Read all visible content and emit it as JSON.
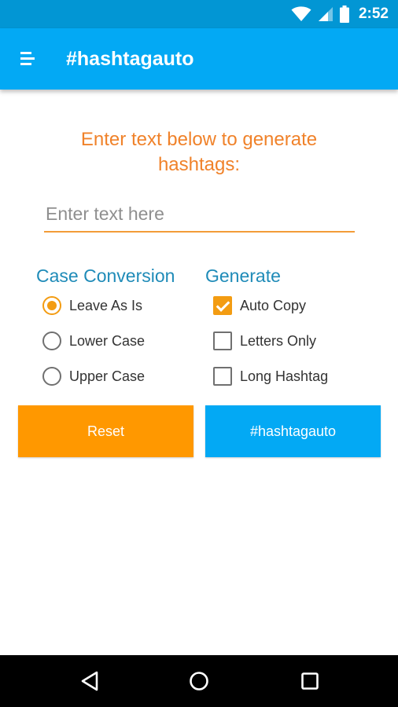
{
  "status_bar": {
    "time": "2:52",
    "icons": [
      "wifi-icon",
      "cellular-signal-icon",
      "battery-icon"
    ]
  },
  "app_bar": {
    "title": "#hashtagauto",
    "menu_icon": "hamburger-menu-icon"
  },
  "main": {
    "instruction": "Enter text below to generate hashtags:",
    "input": {
      "value": "",
      "placeholder": "Enter text here"
    },
    "case_conversion": {
      "header": "Case Conversion",
      "options": [
        {
          "label": "Leave As Is",
          "selected": true
        },
        {
          "label": "Lower Case",
          "selected": false
        },
        {
          "label": "Upper Case",
          "selected": false
        }
      ]
    },
    "generate": {
      "header": "Generate",
      "options": [
        {
          "label": "Auto Copy",
          "checked": true
        },
        {
          "label": "Letters Only",
          "checked": false
        },
        {
          "label": "Long Hashtag",
          "checked": false
        }
      ]
    },
    "buttons": {
      "reset_label": "Reset",
      "generate_label": "#hashtagauto"
    }
  },
  "nav_bar": {
    "icons": [
      "back-icon",
      "home-icon",
      "recents-icon"
    ]
  },
  "colors": {
    "status_bar": "#0296d4",
    "app_bar": "#03a9f4",
    "accent_orange": "#f39c12",
    "instruction_orange": "#f0822a",
    "section_header_blue": "#1f8bb8",
    "reset_button": "#ff9800",
    "generate_button": "#03a9f4"
  }
}
